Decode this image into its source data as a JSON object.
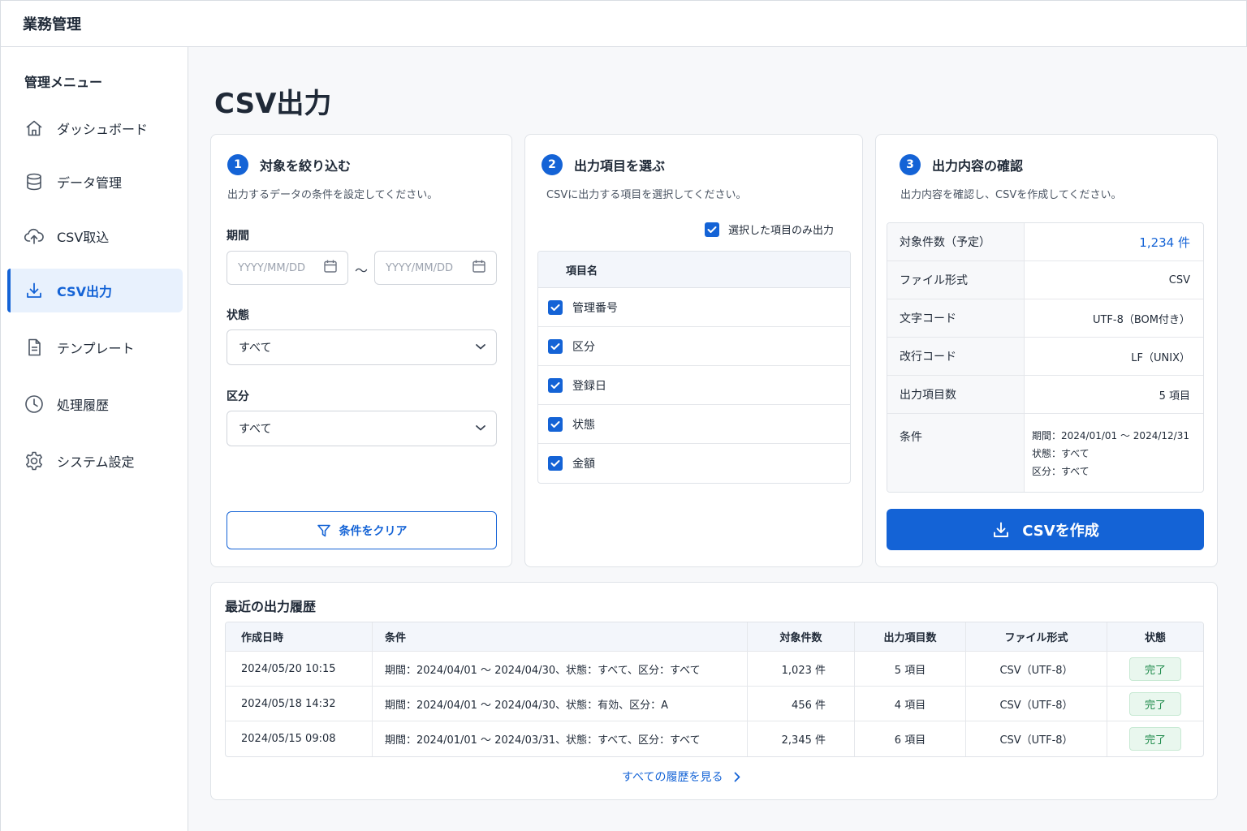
{
  "app": {
    "title": "業務管理"
  },
  "sidebar": {
    "heading": "管理メニュー",
    "items": [
      {
        "label": "ダッシュボード",
        "icon": "home-icon",
        "active": false
      },
      {
        "label": "データ管理",
        "icon": "database-icon",
        "active": false
      },
      {
        "label": "CSV取込",
        "icon": "cloud-upload-icon",
        "active": false
      },
      {
        "label": "CSV出力",
        "icon": "download-icon",
        "active": true
      },
      {
        "label": "テンプレート",
        "icon": "document-icon",
        "active": false
      },
      {
        "label": "処理履歴",
        "icon": "clock-icon",
        "active": false
      },
      {
        "label": "システム設定",
        "icon": "gear-icon",
        "active": false
      }
    ]
  },
  "page": {
    "title": "CSV出力"
  },
  "step1": {
    "num": "1",
    "title": "対象を絞り込む",
    "desc": "出力するデータの条件を設定してください。",
    "period_label": "期間",
    "date_from_placeholder": "YYYY/MM/DD",
    "date_to_placeholder": "YYYY/MM/DD",
    "tilde": "〜",
    "status_label": "状態",
    "status_value": "すべて",
    "category_label": "区分",
    "category_value": "すべて",
    "clear_label": "条件をクリア"
  },
  "step2": {
    "num": "2",
    "title": "出力項目を選ぶ",
    "desc": "CSVに出力する項目を選択してください。",
    "only_selected_label": "選択した項目のみ出力",
    "table_header": "項目名",
    "fields": [
      "管理番号",
      "区分",
      "登録日",
      "状態",
      "金額"
    ]
  },
  "step3": {
    "num": "3",
    "title": "出力内容の確認",
    "desc": "出力内容を確認し、CSVを作成してください。",
    "rows": [
      {
        "key": "対象件数（予定）",
        "value": "1,234 件"
      },
      {
        "key": "ファイル形式",
        "value": "CSV"
      },
      {
        "key": "文字コード",
        "value": "UTF-8（BOM付き）"
      },
      {
        "key": "改行コード",
        "value": "LF（UNIX）"
      },
      {
        "key": "出力項目数",
        "value": "5 項目"
      }
    ],
    "condition_key": "条件",
    "condition_lines": [
      "期間：2024/01/01 〜 2024/12/31",
      "状態：すべて",
      "区分：すべて"
    ],
    "create_label": "CSVを作成"
  },
  "history": {
    "title": "最近の出力履歴",
    "headers": [
      "作成日時",
      "条件",
      "対象件数",
      "出力項目数",
      "ファイル形式",
      "状態"
    ],
    "rows": [
      [
        "2024/05/20 10:15",
        "期間：2024/04/01 〜 2024/04/30、状態：すべて、区分：すべて",
        "1,023 件",
        "5 項目",
        "CSV（UTF-8）",
        "完了"
      ],
      [
        "2024/05/18 14:32",
        "期間：2024/04/01 〜 2024/04/30、状態：有効、区分：A",
        "456 件",
        "4 項目",
        "CSV（UTF-8）",
        "完了"
      ],
      [
        "2024/05/15 09:08",
        "期間：2024/01/01 〜 2024/03/31、状態：すべて、区分：すべて",
        "2,345 件",
        "6 項目",
        "CSV（UTF-8）",
        "完了"
      ]
    ],
    "view_all_label": "すべての履歴を見る"
  },
  "colors": {
    "accent": "#1463d6",
    "success": "#1d8a4a",
    "success_bg": "#e9f7ee"
  }
}
